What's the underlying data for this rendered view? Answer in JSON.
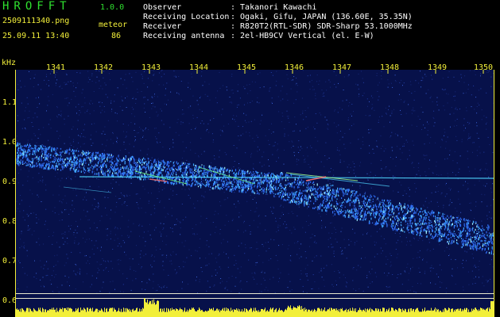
{
  "header": {
    "app_title": "HROFFT",
    "app_version": "1.0.0",
    "filename": "2509111340.png",
    "datetime": "25.09.11 13:40",
    "detector_label": "meteor",
    "detector_value": "86",
    "fields": [
      {
        "label": "Observer",
        "value": ": Takanori Kawachi"
      },
      {
        "label": "Receiving Location",
        "value": ": Ogaki, Gifu, JAPAN (136.60E, 35.35N)"
      },
      {
        "label": "Receiver",
        "value": ": R820T2(RTL-SDR) SDR-Sharp 53.1000MHz"
      },
      {
        "label": "Receiving antenna",
        "value": ": 2el-HB9CV Vertical (el. E-W)"
      }
    ]
  },
  "axis": {
    "y_unit": "kHz",
    "y_ticks": [
      "1.1",
      "1.0",
      "0.9",
      "0.8",
      "0.7",
      "0.6"
    ],
    "x_ticks": [
      "1341",
      "1342",
      "1343",
      "1344",
      "1345",
      "1346",
      "1347",
      "1348",
      "1349",
      "1350"
    ]
  },
  "colors": {
    "text_green": "#2fe02f",
    "text_yellow": "#f2ef3a",
    "background": "#07114a"
  }
}
